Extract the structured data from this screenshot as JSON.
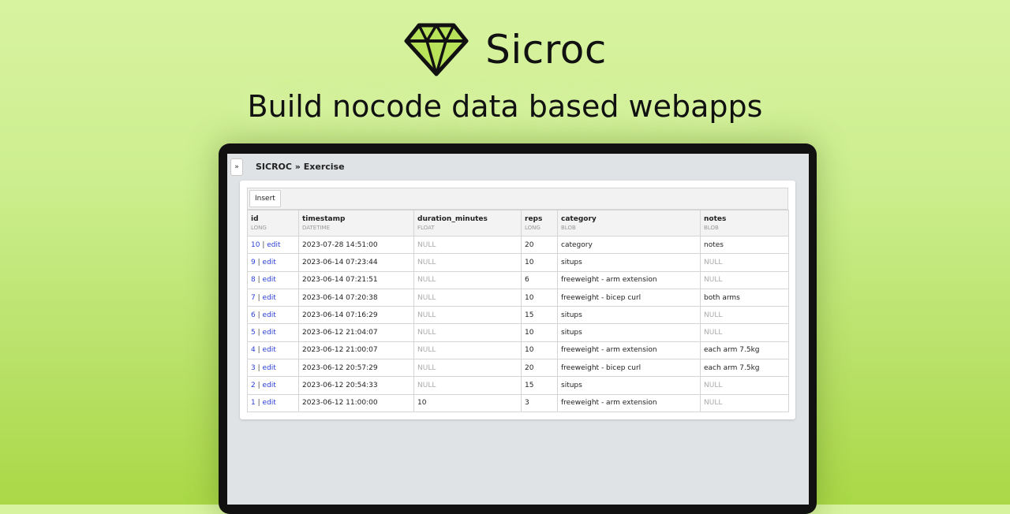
{
  "brand": {
    "name": "Sicroc",
    "tagline": "Build nocode data based webapps",
    "accent_color": "#b8e25a",
    "logo_icon": "diamond-icon"
  },
  "app": {
    "sidebar_toggle": "»",
    "breadcrumb": "SICROC » Exercise",
    "insert_label": "Insert"
  },
  "table": {
    "columns": [
      {
        "name": "id",
        "type": "LONG"
      },
      {
        "name": "timestamp",
        "type": "DATETIME"
      },
      {
        "name": "duration_minutes",
        "type": "FLOAT"
      },
      {
        "name": "reps",
        "type": "LONG"
      },
      {
        "name": "category",
        "type": "BLOB"
      },
      {
        "name": "notes",
        "type": "BLOB"
      }
    ],
    "edit_label": "edit",
    "id_separator": "|",
    "rows": [
      {
        "id": "10",
        "timestamp": "2023-07-28 14:51:00",
        "duration_minutes": "NULL",
        "reps": "20",
        "category": "category",
        "notes": "notes"
      },
      {
        "id": "9",
        "timestamp": "2023-06-14 07:23:44",
        "duration_minutes": "NULL",
        "reps": "10",
        "category": "situps",
        "notes": "NULL"
      },
      {
        "id": "8",
        "timestamp": "2023-06-14 07:21:51",
        "duration_minutes": "NULL",
        "reps": "6",
        "category": "freeweight - arm extension",
        "notes": "NULL"
      },
      {
        "id": "7",
        "timestamp": "2023-06-14 07:20:38",
        "duration_minutes": "NULL",
        "reps": "10",
        "category": "freeweight - bicep curl",
        "notes": "both arms"
      },
      {
        "id": "6",
        "timestamp": "2023-06-14 07:16:29",
        "duration_minutes": "NULL",
        "reps": "15",
        "category": "situps",
        "notes": "NULL"
      },
      {
        "id": "5",
        "timestamp": "2023-06-12 21:04:07",
        "duration_minutes": "NULL",
        "reps": "10",
        "category": "situps",
        "notes": "NULL"
      },
      {
        "id": "4",
        "timestamp": "2023-06-12 21:00:07",
        "duration_minutes": "NULL",
        "reps": "10",
        "category": "freeweight - arm extension",
        "notes": "each arm 7.5kg"
      },
      {
        "id": "3",
        "timestamp": "2023-06-12 20:57:29",
        "duration_minutes": "NULL",
        "reps": "20",
        "category": "freeweight - bicep curl",
        "notes": "each arm 7.5kg"
      },
      {
        "id": "2",
        "timestamp": "2023-06-12 20:54:33",
        "duration_minutes": "NULL",
        "reps": "15",
        "category": "situps",
        "notes": "NULL"
      },
      {
        "id": "1",
        "timestamp": "2023-06-12 11:00:00",
        "duration_minutes": "10",
        "reps": "3",
        "category": "freeweight - arm extension",
        "notes": "NULL"
      }
    ]
  }
}
